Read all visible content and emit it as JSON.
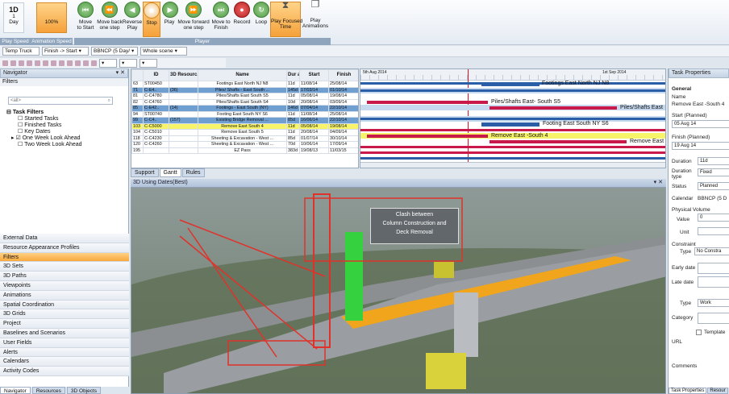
{
  "ribbon": {
    "day_value": "1D",
    "day_combo": "1\nDay",
    "speed_pct": "100%",
    "buttons": [
      {
        "id": "to-start",
        "label": "Move\nto Start"
      },
      {
        "id": "back-step",
        "label": "Move back\none step"
      },
      {
        "id": "reverse",
        "label": "Reverse\nPlay"
      },
      {
        "id": "stop",
        "label": "Stop"
      },
      {
        "id": "play",
        "label": "Play"
      },
      {
        "id": "fwd-step",
        "label": "Move forward\none step"
      },
      {
        "id": "to-finish",
        "label": "Move to\nFinish"
      },
      {
        "id": "record",
        "label": "Record"
      },
      {
        "id": "loop",
        "label": "Loop"
      },
      {
        "id": "play-focused",
        "label": "Play Focused\nTime"
      },
      {
        "id": "play-anim",
        "label": "Play\nAnimations"
      }
    ],
    "groups": [
      "Play Speed",
      "Animation Speed",
      "Player"
    ]
  },
  "toolbar": {
    "truck": "Temp Truck",
    "link": "Finish -> Start",
    "calendar": "BBNCP (5 Day/",
    "scene": "Whole scene"
  },
  "navigator": {
    "title": "Navigator",
    "filters_header": "Filters",
    "search_placeholder": "<all>",
    "tree_root": "Task Filters",
    "tree_items": [
      "Started Tasks",
      "Finished Tasks",
      "Key Dates",
      "One Week Look Ahead",
      "Two Week Look Ahead"
    ],
    "sections": [
      "External Data",
      "Resource Appearance Profiles",
      "Filters",
      "3D Sets",
      "3D Paths",
      "Viewpoints",
      "Animations",
      "Spatial Coordination",
      "3D Grids",
      "Project",
      "Baselines and Scenarios",
      "User Fields",
      "Alerts",
      "Calendars",
      "Activity Codes"
    ],
    "active_section": "Filters",
    "bottom_tabs": [
      "Navigator",
      "Resources",
      "3D Objects"
    ]
  },
  "grid": {
    "headers": [
      "",
      "ID",
      "3D Resourc...",
      "Name",
      "Dur ati...",
      "Start",
      "Finish"
    ],
    "rows": [
      [
        "63",
        "ST00450",
        "",
        "Footings East North NJ N8",
        "11d",
        "11/08/14",
        "25/08/14"
      ],
      [
        "71",
        "C-E4..",
        "(36)",
        "Piles/ Shafts - East South ...",
        "145d",
        "17/03/14",
        "01/10/14"
      ],
      [
        "81",
        "C-C4780",
        "",
        "Piles/Shafts East South S5",
        "11d",
        "05/08/14",
        "19/08/14"
      ],
      [
        "82",
        "C-C4760",
        "",
        "Piles/Shafts East South S4",
        "10d",
        "20/08/14",
        "03/09/14"
      ],
      [
        "85",
        "C-E42..",
        "(14)",
        "Footings - East South (NY)",
        "146d",
        "07/04/14",
        "22/10/14"
      ],
      [
        "94",
        "ST00740",
        "",
        "Footing East South NY S6",
        "11d",
        "11/08/14",
        "25/08/14"
      ],
      [
        "99",
        "C-C4..",
        "(157)",
        "Existing Bridge Removal ...",
        "85d",
        "16/06/14",
        "22/10/14"
      ],
      [
        "103",
        "C-C5000",
        "",
        "Remove East South 4",
        "11d",
        "05/08/14",
        "19/08/14"
      ],
      [
        "104",
        "C-C5010",
        "",
        "Remove East South 5",
        "11d",
        "20/08/14",
        "04/09/14"
      ],
      [
        "118",
        "C-C4230",
        "",
        "Sheeting & Excavation - West ...",
        "85d",
        "01/07/14",
        "30/10/14"
      ],
      [
        "120",
        "C-C4260",
        "",
        "Sheeting & Excavation - West ...",
        "70d",
        "10/06/14",
        "17/09/14"
      ],
      [
        "195",
        "",
        "",
        "EZ Pass",
        "383d",
        "19/08/13",
        "11/03/15"
      ]
    ],
    "tabs": [
      "Support",
      "Gantt",
      "Rules"
    ]
  },
  "gantt": {
    "header_top_left": "5th Aug 2014",
    "header_top_right": "1st Sep 2014",
    "bar_labels": [
      "Footings East North NJ N8",
      "Piles/Shafts East- South S5",
      "Piles/Shafts East",
      "Footing East South NY S6",
      "Remove East -South 4",
      "Remove East"
    ]
  },
  "view3d": {
    "title": "3D Using Dates(Best)",
    "callout": "Clash between\nColumn Construction and\nDeck Removal"
  },
  "props": {
    "title": "Task Properties",
    "general": "General",
    "name_label": "Name",
    "name_value": "Remove East -South 4",
    "start_label": "Start (Planned)",
    "start_value": "05 Aug 14",
    "finish_label": "Finish (Planned)",
    "finish_value": "19 Aug 14",
    "duration_label": "Duration",
    "duration_value": "11d",
    "dur_type_label": "Duration type",
    "dur_type_value": "Fixed",
    "status_label": "Status",
    "status_value": "Planned",
    "calendar_label": "Calendar",
    "calendar_value": "BBNCP (5 D",
    "phys_label": "Physical Volume",
    "value_label": "Value",
    "value_value": "0",
    "unit_label": "Unit",
    "constraint_label": "Constraint",
    "ctype_label": "Type",
    "ctype_value": "No Constra",
    "early_label": "Early date",
    "late_label": "Late date",
    "type_label": "Type",
    "type_value": "Work",
    "category_label": "Category",
    "template_label": "Template",
    "url_label": "URL",
    "comments_label": "Comments",
    "bottom_tabs": [
      "Task Properties",
      "Resour"
    ]
  },
  "colors": {
    "accent": "#f5a13a",
    "selection": "#6f9fd0",
    "highlight": "#f7f46a",
    "bar_red": "#c8194a",
    "bar_blue": "#2a5fa8"
  }
}
